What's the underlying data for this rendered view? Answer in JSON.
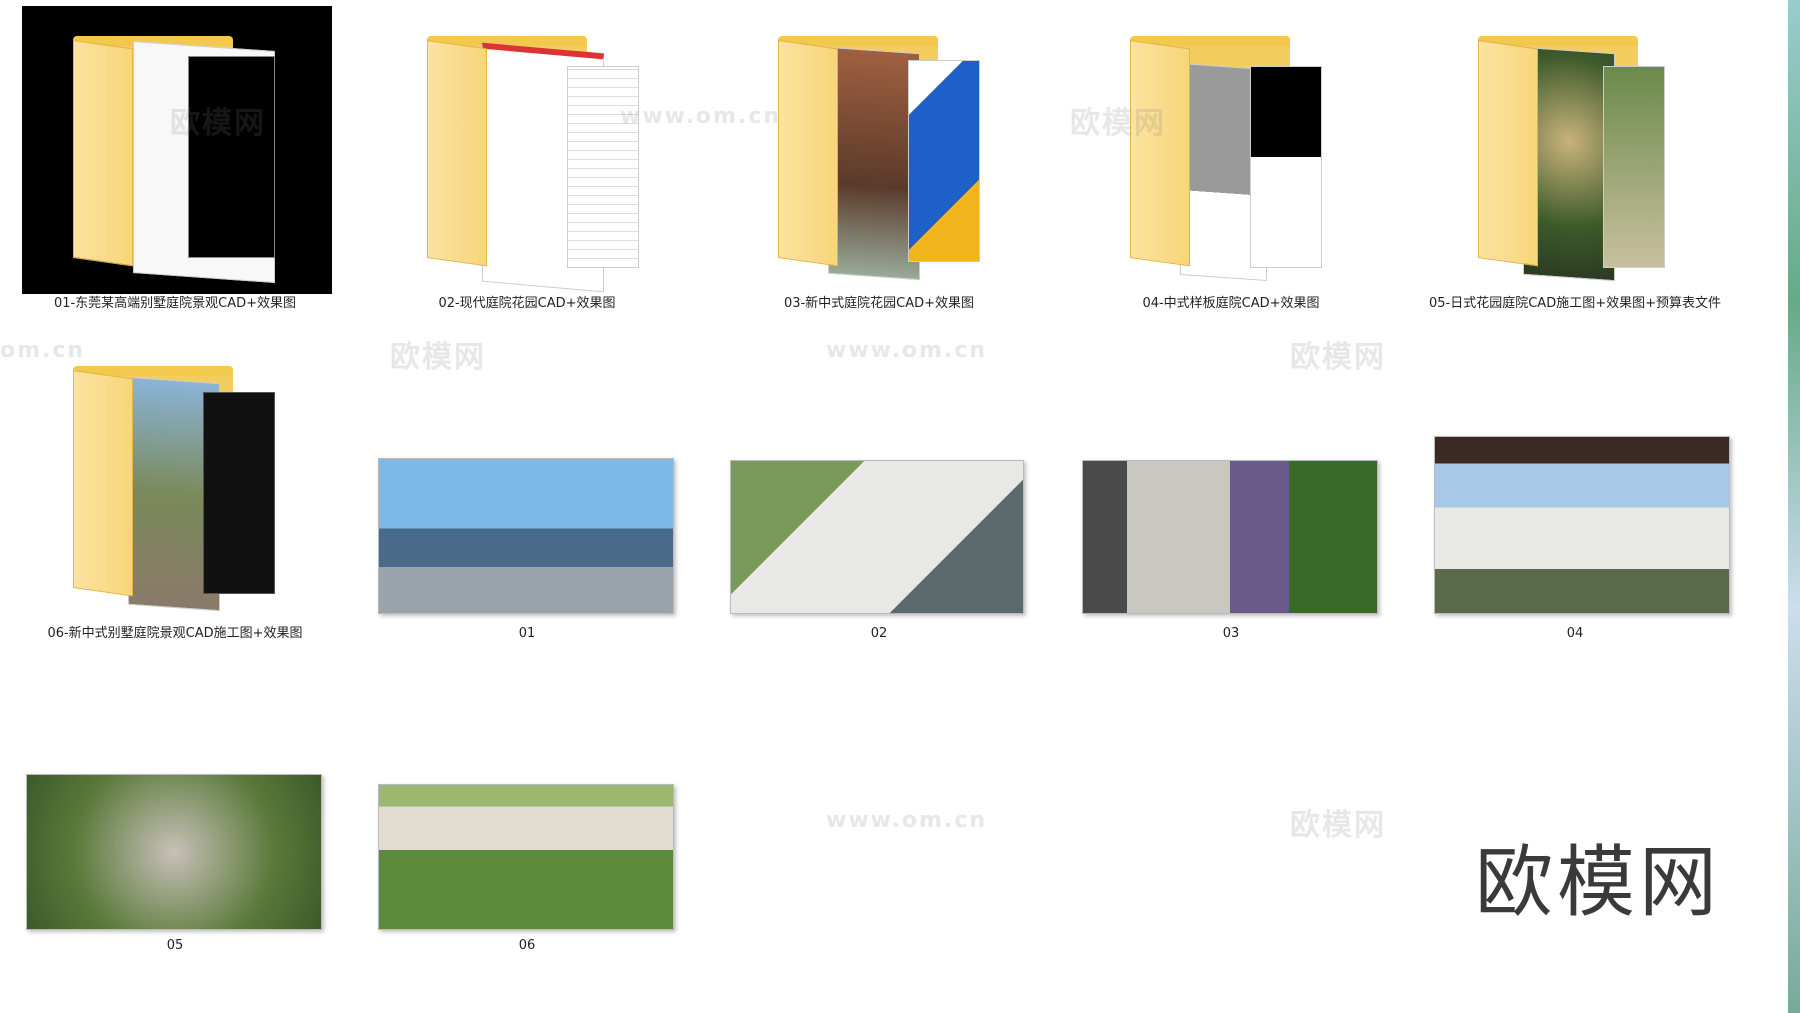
{
  "items": [
    {
      "label": "01-东莞某高端别墅庭院景观CAD+效果图"
    },
    {
      "label": "02-现代庭院花园CAD+效果图"
    },
    {
      "label": "03-新中式庭院花园CAD+效果图"
    },
    {
      "label": "04-中式样板庭院CAD+效果图"
    },
    {
      "label": "05-日式花园庭院CAD施工图+效果图+预算表文件"
    },
    {
      "label": "06-新中式别墅庭院景观CAD施工图+效果图"
    },
    {
      "label": "01"
    },
    {
      "label": "02"
    },
    {
      "label": "03"
    },
    {
      "label": "04"
    },
    {
      "label": "05"
    },
    {
      "label": "06"
    }
  ],
  "watermarks": {
    "cn": "欧模网",
    "url": "www.om.cn",
    "url_short": "om.cn"
  },
  "brand": "欧模网",
  "colors": {
    "folder": "#f4cd60",
    "selected": "#000000"
  }
}
